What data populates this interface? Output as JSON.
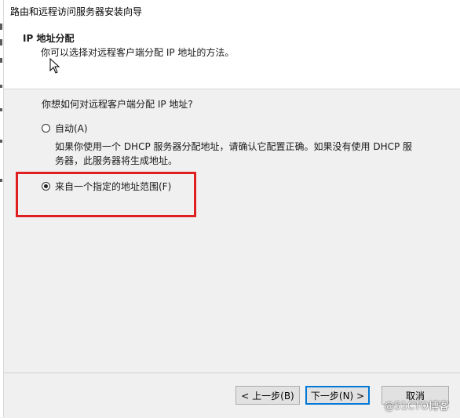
{
  "window": {
    "title": "路由和远程访问服务器安装向导"
  },
  "header": {
    "title": "IP 地址分配",
    "subtitle": "你可以选择对远程客户端分配 IP 地址的方法。"
  },
  "content": {
    "question": "你想如何对远程客户端分配 IP 地址?",
    "options": [
      {
        "label": "自动(A)",
        "selected": false,
        "description_lines": [
          "如果你使用一个 DHCP 服务器分配地址，请确认它配置正确。如果没有使用 DHCP 服",
          "务器，此服务器将生成地址。"
        ]
      },
      {
        "label": "来自一个指定的地址范围(F)",
        "selected": true
      }
    ],
    "highlight_color": "#e02020"
  },
  "footer": {
    "prev_label": "< 上一步(B)",
    "next_label": "下一步(N) >",
    "cancel_label": "取消"
  },
  "watermark": "@51CTO博客"
}
